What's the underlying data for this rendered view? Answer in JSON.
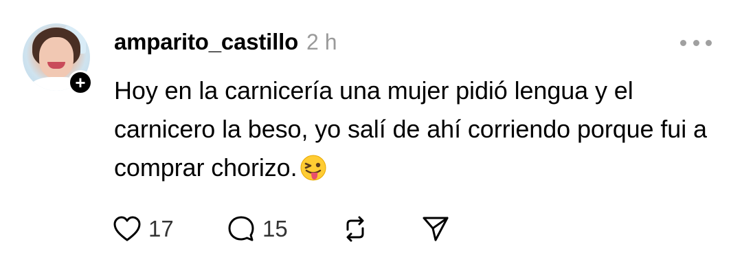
{
  "post": {
    "username": "amparito_castillo",
    "time": "2 h",
    "text": "Hoy en la carnicería una mujer pidió lengua y el carnicero la beso, yo salí de ahí corriendo porque fui a comprar chorizo.",
    "emoji": "winking-face-with-tongue"
  },
  "actions": {
    "like_count": "17",
    "comment_count": "15"
  },
  "icons": [
    "follow-plus-icon",
    "more-options-icon",
    "heart-icon",
    "comment-icon",
    "repost-icon",
    "share-icon"
  ]
}
